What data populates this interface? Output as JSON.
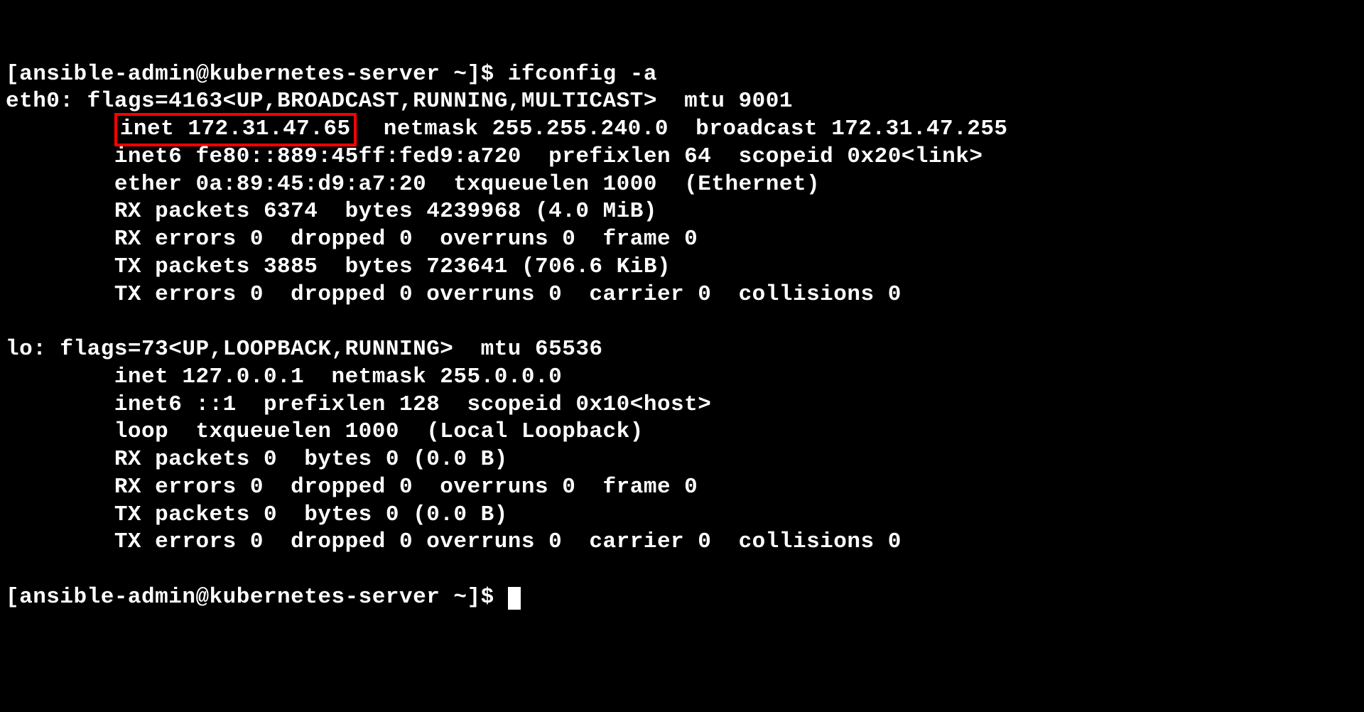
{
  "prompt1_user": "[ansible-admin@kubernetes-server ~]$ ",
  "command": "ifconfig -a",
  "eth0_header": "eth0: flags=4163<UP,BROADCAST,RUNNING,MULTICAST>  mtu 9001",
  "eth0_inet_pre": "        ",
  "eth0_inet_highlight": "inet 172.31.47.65",
  "eth0_inet_post": "  netmask 255.255.240.0  broadcast 172.31.47.255",
  "eth0_inet6": "        inet6 fe80::889:45ff:fed9:a720  prefixlen 64  scopeid 0x20<link>",
  "eth0_ether": "        ether 0a:89:45:d9:a7:20  txqueuelen 1000  (Ethernet)",
  "eth0_rx_packets": "        RX packets 6374  bytes 4239968 (4.0 MiB)",
  "eth0_rx_errors": "        RX errors 0  dropped 0  overruns 0  frame 0",
  "eth0_tx_packets": "        TX packets 3885  bytes 723641 (706.6 KiB)",
  "eth0_tx_errors": "        TX errors 0  dropped 0 overruns 0  carrier 0  collisions 0",
  "blank": "",
  "lo_header": "lo: flags=73<UP,LOOPBACK,RUNNING>  mtu 65536",
  "lo_inet": "        inet 127.0.0.1  netmask 255.0.0.0",
  "lo_inet6": "        inet6 ::1  prefixlen 128  scopeid 0x10<host>",
  "lo_loop": "        loop  txqueuelen 1000  (Local Loopback)",
  "lo_rx_packets": "        RX packets 0  bytes 0 (0.0 B)",
  "lo_rx_errors": "        RX errors 0  dropped 0  overruns 0  frame 0",
  "lo_tx_packets": "        TX packets 0  bytes 0 (0.0 B)",
  "lo_tx_errors": "        TX errors 0  dropped 0 overruns 0  carrier 0  collisions 0",
  "prompt2": "[ansible-admin@kubernetes-server ~]$ "
}
